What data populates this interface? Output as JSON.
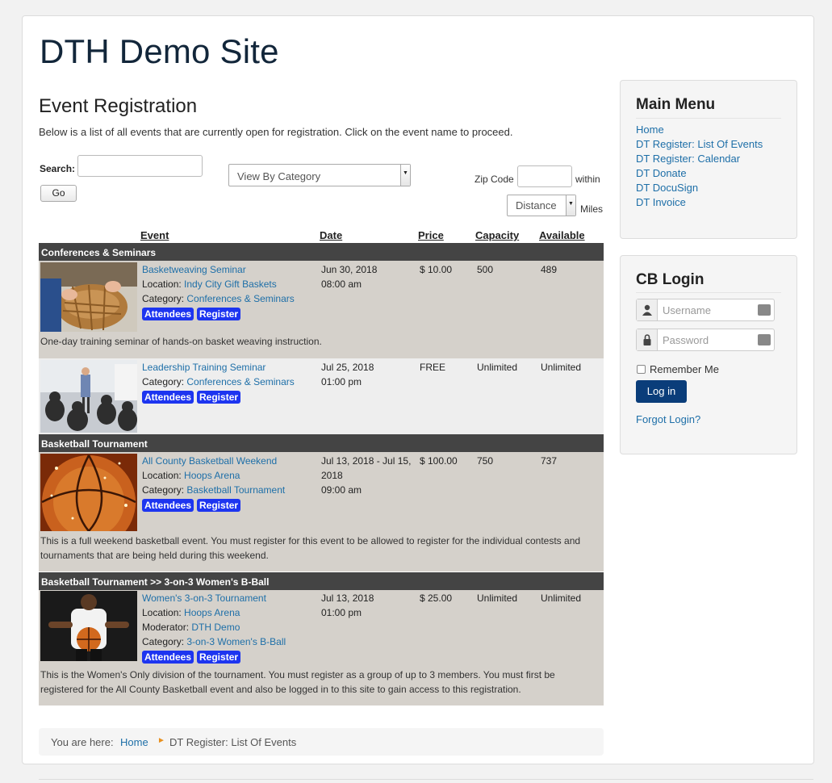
{
  "site": {
    "title": "DTH Demo Site"
  },
  "page": {
    "heading": "Event Registration",
    "intro": "Below is a list of all events that are currently open for registration. Click on the event name to proceed."
  },
  "filters": {
    "search_label": "Search:",
    "go_label": "Go",
    "category_select": "View By Category",
    "zip_label": "Zip Code",
    "within_label": "within",
    "distance_select": "Distance",
    "miles_label": "Miles"
  },
  "table": {
    "headers": [
      "Event",
      "Date",
      "Price",
      "Capacity",
      "Available"
    ]
  },
  "labels": {
    "location": "Location:",
    "category": "Category:",
    "moderator": "Moderator:",
    "attendees": "Attendees",
    "register": "Register"
  },
  "sections": [
    "Conferences & Seminars",
    "Basketball Tournament",
    "Basketball Tournament >> 3-on-3 Women's B-Ball"
  ],
  "events": [
    {
      "name": "Basketweaving Seminar",
      "location": "Indy City Gift Baskets",
      "category": "Conferences & Seminars",
      "date_line1": "Jun 30, 2018",
      "date_line2": "08:00 am",
      "price": "$ 10.00",
      "capacity": "500",
      "available": "489",
      "description": "One-day training seminar of hands-on basket weaving instruction."
    },
    {
      "name": "Leadership Training Seminar",
      "category": "Conferences & Seminars",
      "date_line1": "Jul 25, 2018",
      "date_line2": "01:00 pm",
      "price": "FREE",
      "capacity": "Unlimited",
      "available": "Unlimited"
    },
    {
      "name": "All County Basketball Weekend",
      "location": "Hoops Arena",
      "category": "Basketball Tournament",
      "date_line1": "Jul 13, 2018 - Jul 15,",
      "date_line2": "2018",
      "date_line3": "09:00 am",
      "price": "$ 100.00",
      "capacity": "750",
      "available": "737",
      "desc_line1": "This is a full weekend basketball event. You must register for this event to be allowed to register for the individual contests and",
      "desc_line2": "tournaments that are being held during this weekend."
    },
    {
      "name": "Women's 3-on-3 Tournament",
      "location": "Hoops Arena",
      "moderator": "DTH Demo",
      "category": "3-on-3 Women's B-Ball",
      "date_line1": "Jul 13, 2018",
      "date_line2": "01:00 pm",
      "price": "$ 25.00",
      "capacity": "Unlimited",
      "available": "Unlimited",
      "desc_line1": "This is the Women's Only division of the tournament. You must register as a group of up to 3 members.  You must first be",
      "desc_line2": "registered for the All County Basketball event and also be logged in to this site to gain access to this registration."
    }
  ],
  "breadcrumb": {
    "label": "You are here:",
    "home": "Home",
    "current": "DT Register: List Of Events"
  },
  "main_menu": {
    "title": "Main Menu",
    "items": [
      "Home",
      "DT Register: List Of Events",
      "DT Register: Calendar",
      "DT Donate",
      "DT DocuSign",
      "DT Invoice"
    ]
  },
  "login": {
    "title": "CB Login",
    "username_placeholder": "Username",
    "password_placeholder": "Password",
    "remember": "Remember Me",
    "button": "Log in",
    "forgot": "Forgot Login?"
  },
  "colors": {
    "accent_button": "#1d35f0",
    "section_bar": "#444444",
    "row_bg": "#d5d1cb",
    "link": "#1e6fa8",
    "login_button": "#0a3d7a"
  }
}
